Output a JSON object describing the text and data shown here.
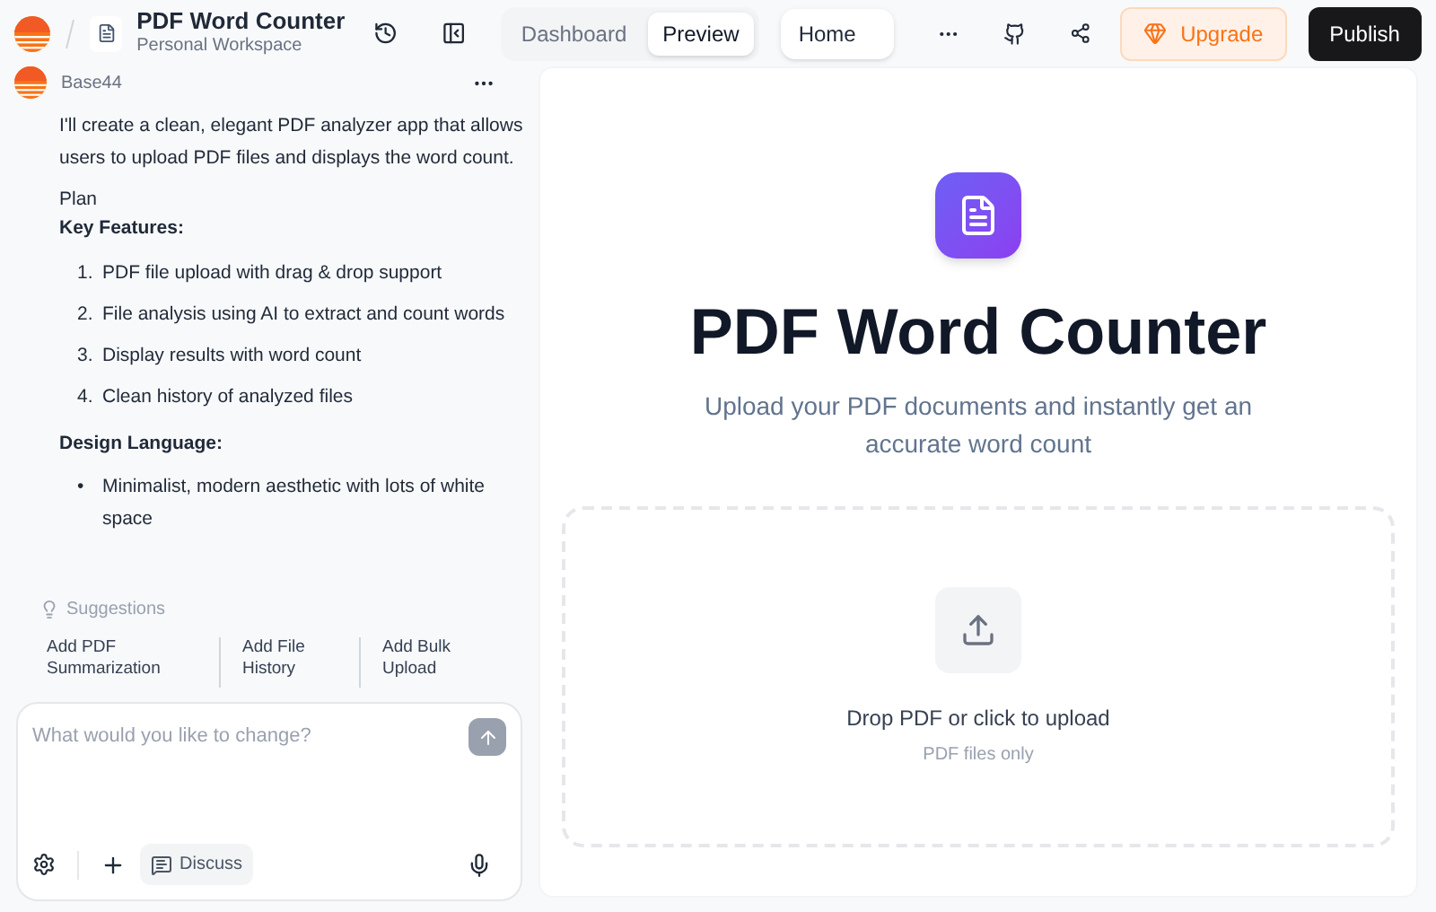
{
  "header": {
    "project_title": "PDF Word Counter",
    "workspace": "Personal Workspace",
    "tabs": [
      {
        "label": "Dashboard",
        "selected": false
      },
      {
        "label": "Preview",
        "selected": true
      }
    ],
    "route": "Home",
    "upgrade": "Upgrade",
    "publish": "Publish"
  },
  "chat": {
    "author": "Base44",
    "intro": "I'll create a clean, elegant PDF analyzer app that allows users to upload PDF files and displays the word count.",
    "plan": "Plan",
    "features_heading": "Key Features:",
    "features": [
      {
        "marker": "1.",
        "text": "PDF file upload with drag & drop support"
      },
      {
        "marker": "2.",
        "text": "File analysis using AI to extract and count words"
      },
      {
        "marker": "3.",
        "text": "Display results with word count"
      },
      {
        "marker": "4.",
        "text": "Clean history of analyzed files"
      }
    ],
    "design_heading": "Design Language:",
    "design": [
      {
        "marker": "•",
        "text": "Minimalist, modern aesthetic with lots of white space"
      }
    ]
  },
  "suggestions": {
    "label": "Suggestions",
    "items": [
      "Add PDF Summarization",
      "Add File History",
      "Add Bulk Upload"
    ]
  },
  "composer": {
    "placeholder": "What would you like to change?",
    "discuss": "Discuss"
  },
  "preview": {
    "title": "PDF Word Counter",
    "subtitle": "Upload your PDF documents and instantly get an accurate word count",
    "drop_label": "Drop PDF or click to upload",
    "drop_hint": "PDF files only"
  }
}
